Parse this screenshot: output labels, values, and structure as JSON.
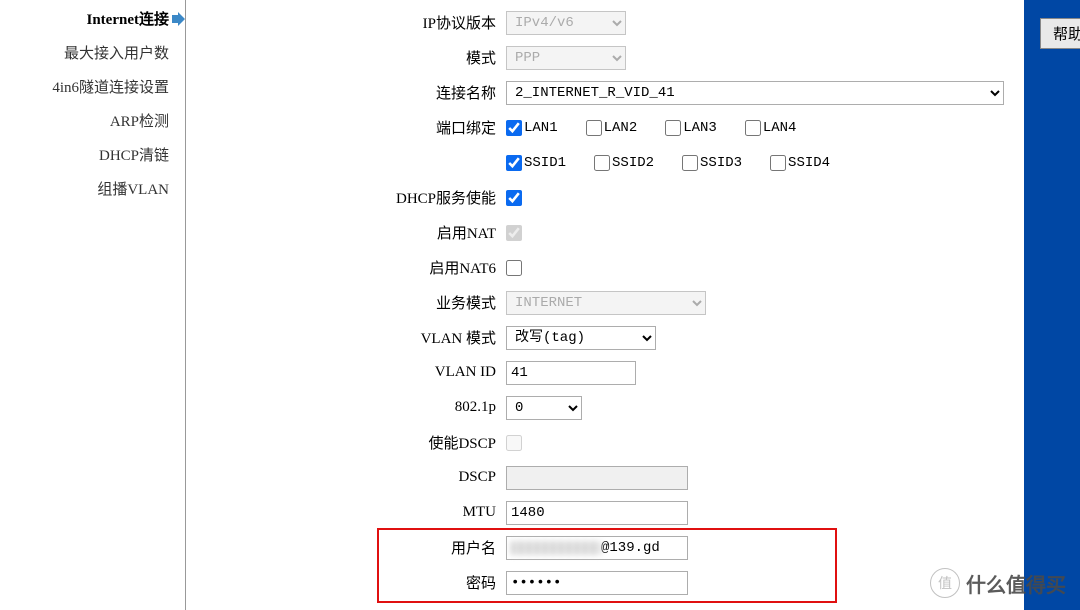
{
  "sidebar": {
    "items": [
      {
        "label": "Internet连接",
        "active": true
      },
      {
        "label": "最大接入用户数",
        "active": false
      },
      {
        "label": "4in6隧道连接设置",
        "active": false
      },
      {
        "label": "ARP检测",
        "active": false
      },
      {
        "label": "DHCP清链",
        "active": false
      },
      {
        "label": "组播VLAN",
        "active": false
      }
    ]
  },
  "form": {
    "ip_protocol": {
      "label": "IP协议版本",
      "value": "IPv4/v6"
    },
    "mode": {
      "label": "模式",
      "value": "PPP"
    },
    "conn_name": {
      "label": "连接名称",
      "value": "2_INTERNET_R_VID_41"
    },
    "port_bind": {
      "label": "端口绑定"
    },
    "lan": [
      {
        "label": "LAN1",
        "checked": true
      },
      {
        "label": "LAN2",
        "checked": false
      },
      {
        "label": "LAN3",
        "checked": false
      },
      {
        "label": "LAN4",
        "checked": false
      }
    ],
    "ssid": [
      {
        "label": "SSID1",
        "checked": true
      },
      {
        "label": "SSID2",
        "checked": false
      },
      {
        "label": "SSID3",
        "checked": false
      },
      {
        "label": "SSID4",
        "checked": false
      }
    ],
    "dhcp_enable": {
      "label": "DHCP服务使能",
      "checked": true
    },
    "nat": {
      "label": "启用NAT",
      "checked": true,
      "disabled": true
    },
    "nat6": {
      "label": "启用NAT6",
      "checked": false
    },
    "svc_mode": {
      "label": "业务模式",
      "value": "INTERNET"
    },
    "vlan_mode": {
      "label": "VLAN 模式",
      "value": "改写(tag)"
    },
    "vlan_id": {
      "label": "VLAN ID",
      "value": "41"
    },
    "p8021": {
      "label": "802.1p",
      "value": "0"
    },
    "dscp_en": {
      "label": "使能DSCP",
      "checked": false
    },
    "dscp": {
      "label": "DSCP",
      "value": ""
    },
    "mtu": {
      "label": "MTU",
      "value": "1480"
    },
    "user": {
      "label": "用户名",
      "suffix": "@139.gd"
    },
    "password": {
      "label": "密码",
      "value": "••••••"
    }
  },
  "help_button": "帮助",
  "watermark": {
    "icon_text": "值",
    "text": "什么值得买"
  }
}
